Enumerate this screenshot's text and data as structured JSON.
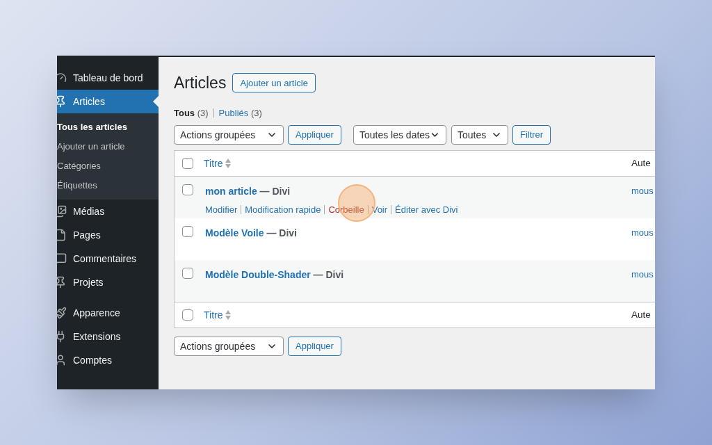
{
  "sidebar": {
    "items": [
      {
        "label": "Tableau de bord",
        "selected": false
      },
      {
        "label": "Articles",
        "selected": true,
        "children": [
          {
            "label": "Tous les articles",
            "selected": true
          },
          {
            "label": "Ajouter un article",
            "selected": false
          },
          {
            "label": "Catégories",
            "selected": false
          },
          {
            "label": "Étiquettes",
            "selected": false
          }
        ]
      },
      {
        "label": "Médias",
        "selected": false
      },
      {
        "label": "Pages",
        "selected": false
      },
      {
        "label": "Commentaires",
        "selected": false
      },
      {
        "label": "Projets",
        "selected": false
      },
      {
        "label": "Apparence",
        "selected": false
      },
      {
        "label": "Extensions",
        "selected": false
      },
      {
        "label": "Comptes",
        "selected": false
      }
    ]
  },
  "page": {
    "title": "Articles",
    "add_button": "Ajouter un article"
  },
  "views": [
    {
      "label": "Tous",
      "count": "(3)",
      "selected": true
    },
    {
      "label": "Publiés",
      "count": "(3)",
      "selected": false
    }
  ],
  "top_toolbar": {
    "bulk_select": "Actions groupées",
    "apply": "Appliquer",
    "date_select": "Toutes les dates",
    "category_select": "Toutes",
    "filter": "Filtrer"
  },
  "table": {
    "columns": [
      "Titre",
      "Aute"
    ],
    "header_checked": false,
    "footer_checked": false,
    "rows": [
      {
        "title": "mon article",
        "suffix": "— Divi",
        "author": "mous",
        "checked": false,
        "actions": [
          {
            "label": "Modifier",
            "kind": "link"
          },
          {
            "label": "Modification rapide",
            "kind": "link"
          },
          {
            "label": "Corbeille",
            "kind": "delete"
          },
          {
            "label": "Voir",
            "kind": "link"
          },
          {
            "label": "Éditer avec Divi",
            "kind": "link"
          }
        ]
      },
      {
        "title": "Modèle Voile",
        "suffix": "— Divi",
        "author": "mous",
        "checked": false
      },
      {
        "title": "Modèle Double-Shader",
        "suffix": "— Divi",
        "author": "mous",
        "checked": false
      }
    ],
    "footer_columns": [
      "Titre",
      "Aute"
    ]
  },
  "bottom_toolbar": {
    "bulk_select": "Actions groupées",
    "apply": "Appliquer"
  }
}
